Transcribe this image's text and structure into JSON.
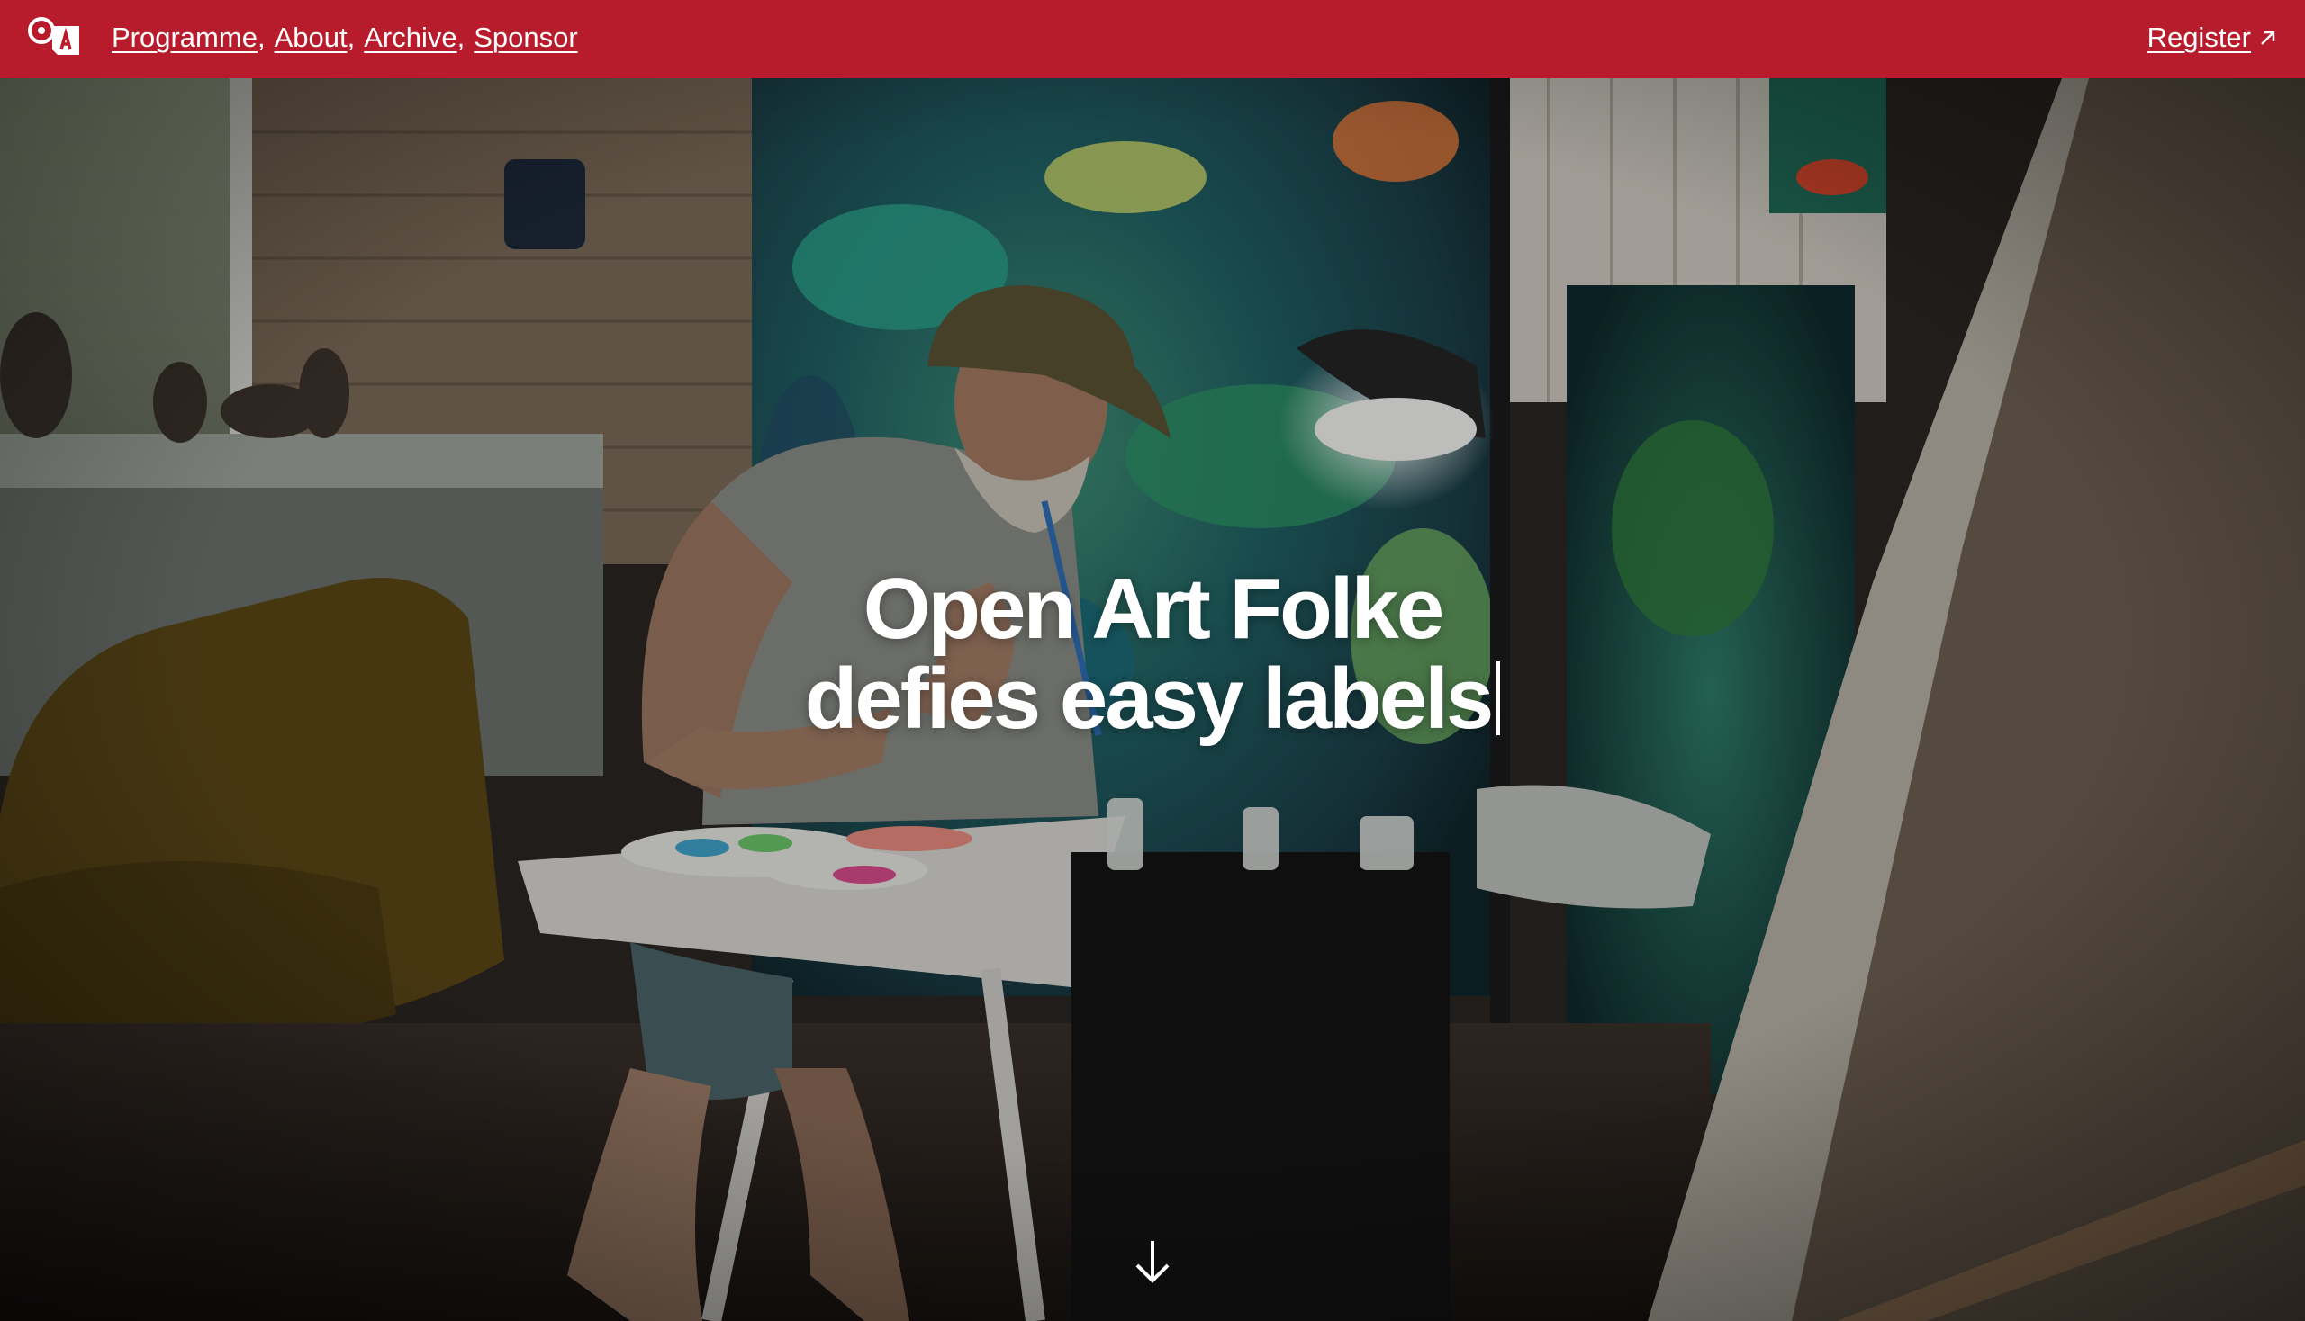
{
  "header": {
    "logo_icon": "open-art-logo-icon",
    "nav": [
      {
        "label": "Programme"
      },
      {
        "label": "About"
      },
      {
        "label": "Archive"
      },
      {
        "label": "Sponsor"
      }
    ],
    "separator": ",",
    "register_label": "Register",
    "register_icon": "arrow-up-right-icon",
    "bar_color": "#b81c2c"
  },
  "hero": {
    "headline_line1": "Open Art Folke",
    "headline_line2": "defies easy labels",
    "scroll_icon": "arrow-down-icon"
  }
}
